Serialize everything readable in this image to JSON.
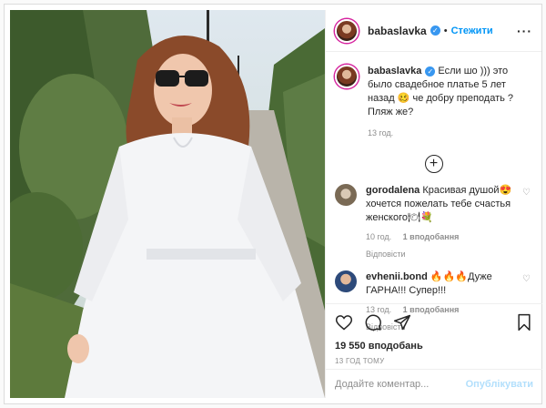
{
  "post": {
    "username": "babaslavka",
    "follow_label": "Стежити",
    "more_label": "···",
    "caption": {
      "username": "babaslavka",
      "text": "Если шо ))) это было свадебное платье 5 лет назад 🥴 че добру преподать ? Пляж же?",
      "age": "13 год."
    }
  },
  "comments": [
    {
      "username": "gorodalena",
      "text": "Красивая душой😍 хочется пожелать тебе счастья женского🍽💐",
      "age": "10 год.",
      "likes": "1 вподобання",
      "reply": "Відповісти"
    },
    {
      "username": "evhenii.bond",
      "text": "🔥🔥🔥Дуже ГАРНА!!! Супер!!!",
      "age": "13 год.",
      "likes": "1 вподобання",
      "reply": "Відповісти"
    }
  ],
  "stats": {
    "likes": "19 550 вподобань",
    "posted": "13 ГОД ТОМУ"
  },
  "compose": {
    "placeholder": "Додайте коментар...",
    "publish_label": "Опублікувати"
  }
}
